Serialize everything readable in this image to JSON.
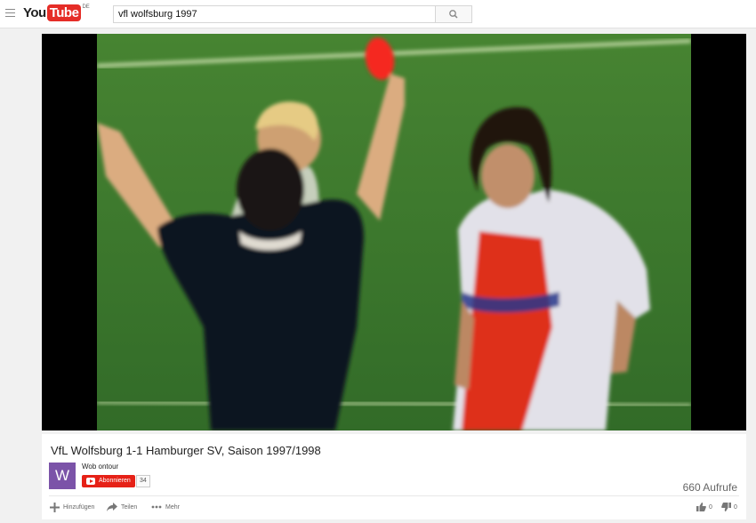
{
  "masthead": {
    "logo_you": "You",
    "logo_tube": "Tube",
    "logo_region": "DE",
    "search_value": "vfl wolfsburg 1997"
  },
  "video": {
    "title": "VfL Wolfsburg 1-1 Hamburger SV, Saison 1997/1998",
    "views": "660 Aufrufe"
  },
  "channel": {
    "avatar_letter": "W",
    "name": "Wob ontour",
    "subscribe_label": "Abonnieren",
    "subscriber_count": "34"
  },
  "actions": {
    "add_label": "Hinzufügen",
    "share_label": "Teilen",
    "more_label": "Mehr",
    "likes": "0",
    "dislikes": "0"
  },
  "colors": {
    "brand_red": "#e52d27",
    "subscribe_red": "#e62117",
    "avatar_purple": "#7b53a8",
    "pitch_green": "#3f7a2c"
  },
  "icons": [
    "menu-icon",
    "search-icon",
    "add-icon",
    "share-icon",
    "more-icon",
    "thumbs-up-icon",
    "thumbs-down-icon",
    "youtube-play-icon"
  ]
}
